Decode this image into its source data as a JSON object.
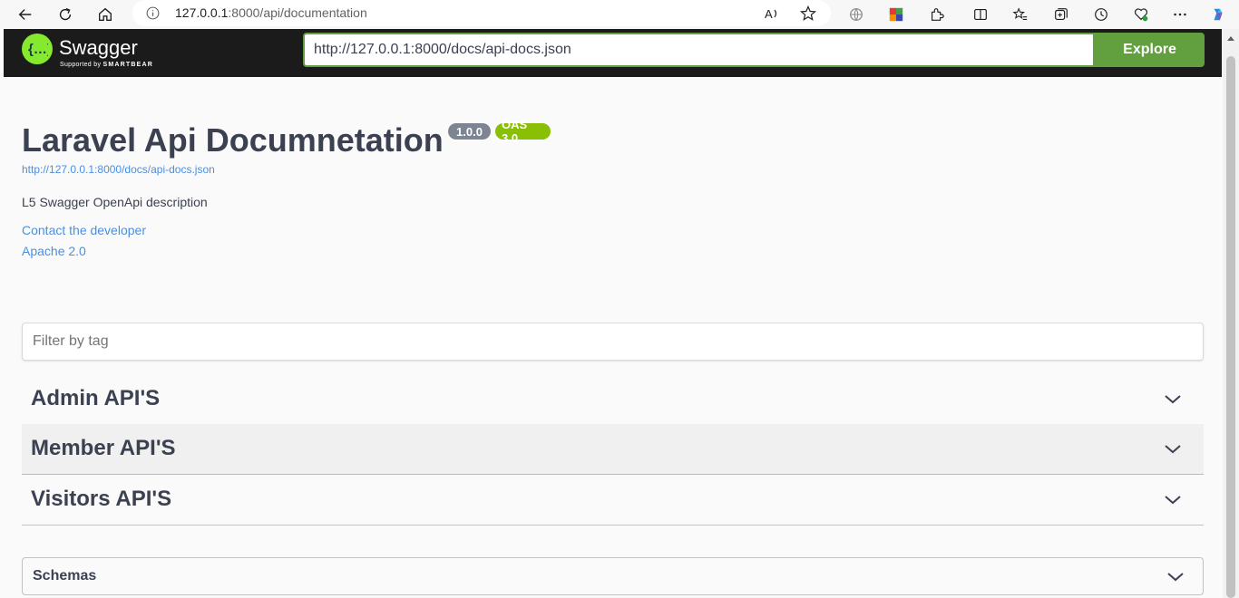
{
  "browser": {
    "url_host": "127.0.0.1",
    "url_rest": ":8000/api/documentation"
  },
  "topbar": {
    "logo_name": "Swagger",
    "logo_supported": "Supported by",
    "logo_company": "SMARTBEAR",
    "spec_url_value": "http://127.0.0.1:8000/docs/api-docs.json",
    "explore_label": "Explore",
    "accent_color": "#62a03f"
  },
  "info": {
    "title": "Laravel Api Documnetation",
    "version_badge": "1.0.0",
    "oas_badge": "OAS 3.0",
    "spec_link": "http://127.0.0.1:8000/docs/api-docs.json",
    "description": "L5 Swagger OpenApi description",
    "contact_link": "Contact the developer",
    "license_link": "Apache 2.0"
  },
  "filter": {
    "placeholder": "Filter by tag"
  },
  "tags": [
    {
      "label": "Admin API'S"
    },
    {
      "label": "Member API'S"
    },
    {
      "label": "Visitors API'S"
    }
  ],
  "schemas": {
    "label": "Schemas"
  }
}
